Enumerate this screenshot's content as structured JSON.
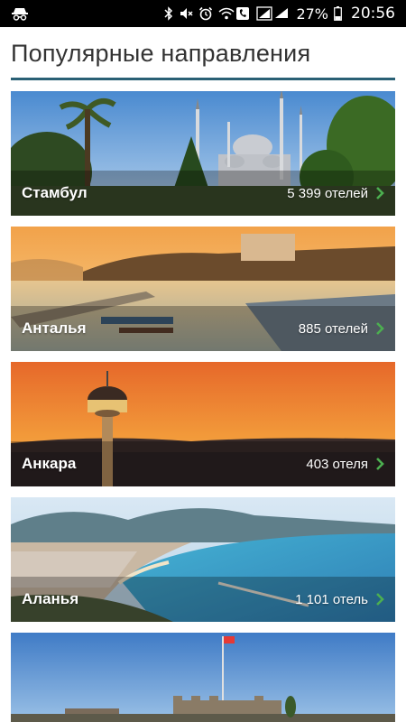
{
  "status_bar": {
    "battery_percent": "27%",
    "time": "20:56",
    "icons": [
      "incognito-icon",
      "bluetooth-icon",
      "mute-icon",
      "alarm-icon",
      "wifi-call-icon",
      "signal-icon",
      "battery-icon"
    ]
  },
  "page": {
    "title": "Популярные направления",
    "accent_color": "#2a6075",
    "chevron_color": "#4caf50"
  },
  "destinations": [
    {
      "city": "Стамбул",
      "hotels": "5 399 отелей"
    },
    {
      "city": "Анталья",
      "hotels": "885 отелей"
    },
    {
      "city": "Анкара",
      "hotels": "403 отеля"
    },
    {
      "city": "Аланья",
      "hotels": "1 101 отель"
    },
    {
      "city": "",
      "hotels": ""
    }
  ]
}
